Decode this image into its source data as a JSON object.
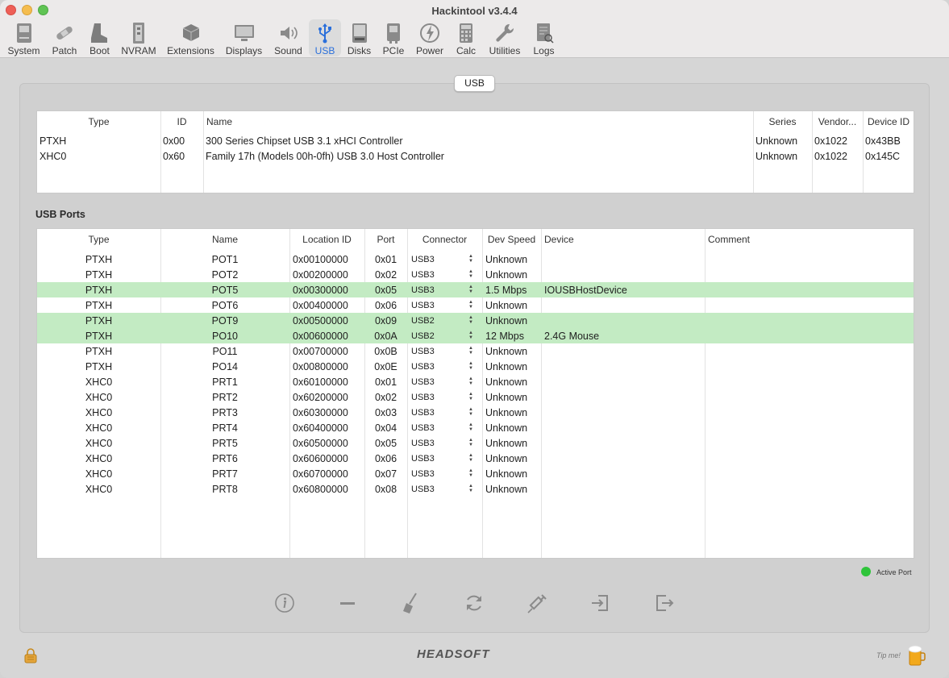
{
  "window": {
    "title": "Hackintool v3.4.4"
  },
  "toolbar": {
    "items": [
      {
        "label": "System",
        "icon": "system-icon"
      },
      {
        "label": "Patch",
        "icon": "patch-icon"
      },
      {
        "label": "Boot",
        "icon": "boot-icon"
      },
      {
        "label": "NVRAM",
        "icon": "nvram-icon"
      },
      {
        "label": "Extensions",
        "icon": "extensions-icon"
      },
      {
        "label": "Displays",
        "icon": "displays-icon"
      },
      {
        "label": "Sound",
        "icon": "sound-icon"
      },
      {
        "label": "USB",
        "icon": "usb-icon",
        "active": true
      },
      {
        "label": "Disks",
        "icon": "disks-icon"
      },
      {
        "label": "PCIe",
        "icon": "pcie-icon"
      },
      {
        "label": "Power",
        "icon": "power-icon"
      },
      {
        "label": "Calc",
        "icon": "calc-icon"
      },
      {
        "label": "Utilities",
        "icon": "utilities-icon"
      },
      {
        "label": "Logs",
        "icon": "logs-icon"
      }
    ]
  },
  "panel": {
    "tab_label": "USB"
  },
  "controllers": {
    "columns": [
      "Type",
      "ID",
      "Name",
      "Series",
      "Vendor...",
      "Device ID"
    ],
    "rows": [
      {
        "type": "PTXH",
        "id": "0x00",
        "name": "300 Series Chipset USB 3.1 xHCI Controller",
        "series": "Unknown",
        "vendor": "0x1022",
        "device_id": "0x43BB"
      },
      {
        "type": "XHC0",
        "id": "0x60",
        "name": "Family 17h (Models 00h-0fh) USB 3.0 Host Controller",
        "series": "Unknown",
        "vendor": "0x1022",
        "device_id": "0x145C"
      }
    ]
  },
  "ports_section": {
    "title": "USB Ports"
  },
  "ports": {
    "columns": [
      "Type",
      "Name",
      "Location ID",
      "Port",
      "Connector",
      "Dev Speed",
      "Device",
      "Comment"
    ],
    "rows": [
      {
        "type": "PTXH",
        "name": "POT1",
        "location": "0x00100000",
        "port": "0x01",
        "connector": "USB3",
        "speed": "Unknown",
        "device": "",
        "comment": "",
        "active": false
      },
      {
        "type": "PTXH",
        "name": "POT2",
        "location": "0x00200000",
        "port": "0x02",
        "connector": "USB3",
        "speed": "Unknown",
        "device": "",
        "comment": "",
        "active": false
      },
      {
        "type": "PTXH",
        "name": "POT5",
        "location": "0x00300000",
        "port": "0x05",
        "connector": "USB3",
        "speed": "1.5 Mbps",
        "device": "IOUSBHostDevice",
        "comment": "",
        "active": true
      },
      {
        "type": "PTXH",
        "name": "POT6",
        "location": "0x00400000",
        "port": "0x06",
        "connector": "USB3",
        "speed": "Unknown",
        "device": "",
        "comment": "",
        "active": false
      },
      {
        "type": "PTXH",
        "name": "POT9",
        "location": "0x00500000",
        "port": "0x09",
        "connector": "USB2",
        "speed": "Unknown",
        "device": "",
        "comment": "",
        "active": true
      },
      {
        "type": "PTXH",
        "name": "PO10",
        "location": "0x00600000",
        "port": "0x0A",
        "connector": "USB2",
        "speed": "12 Mbps",
        "device": "2.4G Mouse",
        "comment": "",
        "active": true
      },
      {
        "type": "PTXH",
        "name": "PO11",
        "location": "0x00700000",
        "port": "0x0B",
        "connector": "USB3",
        "speed": "Unknown",
        "device": "",
        "comment": "",
        "active": false
      },
      {
        "type": "PTXH",
        "name": "PO14",
        "location": "0x00800000",
        "port": "0x0E",
        "connector": "USB3",
        "speed": "Unknown",
        "device": "",
        "comment": "",
        "active": false
      },
      {
        "type": "XHC0",
        "name": "PRT1",
        "location": "0x60100000",
        "port": "0x01",
        "connector": "USB3",
        "speed": "Unknown",
        "device": "",
        "comment": "",
        "active": false
      },
      {
        "type": "XHC0",
        "name": "PRT2",
        "location": "0x60200000",
        "port": "0x02",
        "connector": "USB3",
        "speed": "Unknown",
        "device": "",
        "comment": "",
        "active": false
      },
      {
        "type": "XHC0",
        "name": "PRT3",
        "location": "0x60300000",
        "port": "0x03",
        "connector": "USB3",
        "speed": "Unknown",
        "device": "",
        "comment": "",
        "active": false
      },
      {
        "type": "XHC0",
        "name": "PRT4",
        "location": "0x60400000",
        "port": "0x04",
        "connector": "USB3",
        "speed": "Unknown",
        "device": "",
        "comment": "",
        "active": false
      },
      {
        "type": "XHC0",
        "name": "PRT5",
        "location": "0x60500000",
        "port": "0x05",
        "connector": "USB3",
        "speed": "Unknown",
        "device": "",
        "comment": "",
        "active": false
      },
      {
        "type": "XHC0",
        "name": "PRT6",
        "location": "0x60600000",
        "port": "0x06",
        "connector": "USB3",
        "speed": "Unknown",
        "device": "",
        "comment": "",
        "active": false
      },
      {
        "type": "XHC0",
        "name": "PRT7",
        "location": "0x60700000",
        "port": "0x07",
        "connector": "USB3",
        "speed": "Unknown",
        "device": "",
        "comment": "",
        "active": false
      },
      {
        "type": "XHC0",
        "name": "PRT8",
        "location": "0x60800000",
        "port": "0x08",
        "connector": "USB3",
        "speed": "Unknown",
        "device": "",
        "comment": "",
        "active": false
      }
    ]
  },
  "legend": {
    "label": "Active Port",
    "color": "#2ec43a"
  },
  "highlight_color": "#c3ebc3",
  "accent_color": "#2a6fdb",
  "bottom_actions": [
    {
      "name": "info-icon"
    },
    {
      "name": "minus-icon"
    },
    {
      "name": "broom-icon"
    },
    {
      "name": "refresh-icon"
    },
    {
      "name": "syringe-icon"
    },
    {
      "name": "import-icon"
    },
    {
      "name": "export-icon"
    }
  ],
  "footer": {
    "brand": "HEADSOFT",
    "tip": "Tip me!"
  }
}
